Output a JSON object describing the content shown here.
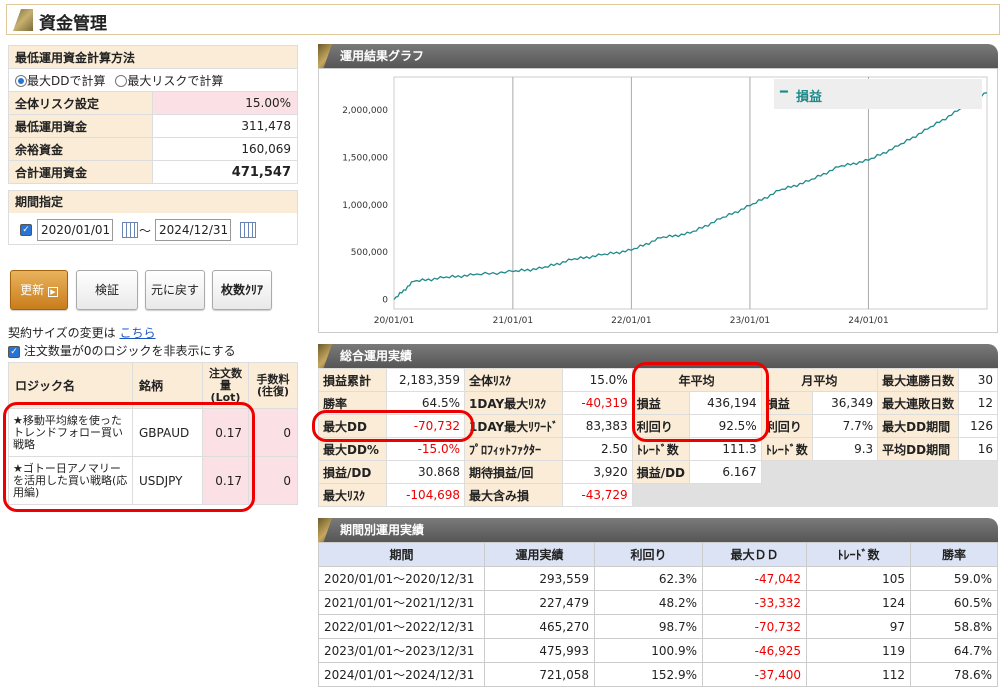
{
  "header": {
    "title": "資金管理"
  },
  "calc": {
    "section_title": "最低運用資金計算方法",
    "radio1": "最大DDで計算",
    "radio2": "最大リスクで計算",
    "rows": [
      {
        "label": "全体リスク設定",
        "value": "15.00%"
      },
      {
        "label": "最低運用資金",
        "value": "311,478"
      },
      {
        "label": "余裕資金",
        "value": "160,069"
      },
      {
        "label": "合計運用資金",
        "value": "471,547"
      }
    ]
  },
  "period": {
    "section_title": "期間指定",
    "from": "2020/01/01",
    "sep": "～",
    "to": "2024/12/31"
  },
  "buttons": {
    "update": "更新",
    "verify": "検証",
    "reset": "元に戻す",
    "clear": "枚数ｸﾘｱ"
  },
  "contract": {
    "text": "契約サイズの変更は",
    "link": "こちら",
    "hide_zero": "注文数量が0のロジックを非表示にする"
  },
  "logic_table": {
    "headers": {
      "name": "ロジック名",
      "symbol": "銘柄",
      "lot": "注文数量(Lot)",
      "fee": "手数料(往復)"
    },
    "rows": [
      {
        "name": "★移動平均線を使ったトレンドフォロー買い戦略",
        "symbol": "GBPAUD",
        "lot": "0.17",
        "fee": "0"
      },
      {
        "name": "★ゴトー日アノマリーを活用した買い戦略(応用編)",
        "symbol": "USDJPY",
        "lot": "0.17",
        "fee": "0"
      }
    ]
  },
  "graph": {
    "section_title": "運用結果グラフ"
  },
  "chart_data": {
    "type": "line",
    "title": "",
    "legend": "損益",
    "legend_position": "top-right",
    "grid": true,
    "x_ticks": [
      "20/01/01",
      "21/01/01",
      "22/01/01",
      "23/01/01",
      "24/01/01"
    ],
    "y_ticks": [
      "0",
      "500,000",
      "1,000,000",
      "1,500,000",
      "2,000,000"
    ],
    "ylim": [
      -100000,
      2350000
    ],
    "series": [
      {
        "name": "損益",
        "color": "#1f8a8a",
        "x": [
          "2020-01-01",
          "2020-03-01",
          "2020-06-01",
          "2020-09-01",
          "2021-01-01",
          "2021-04-01",
          "2021-07-01",
          "2021-10-01",
          "2022-01-01",
          "2022-04-01",
          "2022-07-01",
          "2022-10-01",
          "2023-01-01",
          "2023-04-01",
          "2023-07-01",
          "2023-10-01",
          "2024-01-01",
          "2024-04-01",
          "2024-07-01",
          "2024-10-01",
          "2024-12-31"
        ],
        "values": [
          0,
          190000,
          230000,
          260000,
          295000,
          330000,
          420000,
          470000,
          520000,
          650000,
          700000,
          850000,
          990000,
          1150000,
          1250000,
          1400000,
          1470000,
          1620000,
          1800000,
          1990000,
          2183359
        ]
      }
    ]
  },
  "summary": {
    "section_title": "総合運用実績",
    "col1": [
      {
        "k": "損益累計",
        "v": "2,183,359"
      },
      {
        "k": "勝率",
        "v": "64.5%"
      },
      {
        "k": "最大DD",
        "v": "-70,732",
        "red": true
      },
      {
        "k": "最大DD%",
        "v": "-15.0%",
        "red": true
      },
      {
        "k": "損益/DD",
        "v": "30.868"
      },
      {
        "k": "最大ﾘｽｸ",
        "v": "-104,698",
        "red": true
      }
    ],
    "col2": [
      {
        "k": "全体ﾘｽｸ",
        "v": "15.0%"
      },
      {
        "k": "1DAY最大ﾘｽｸ",
        "v": "-40,319",
        "red": true
      },
      {
        "k": "1DAY最大ﾘﾜｰﾄﾞ",
        "v": "83,383"
      },
      {
        "k": "ﾌﾟﾛﾌｨｯﾄﾌｧｸﾀｰ",
        "v": "2.50"
      },
      {
        "k": "期待損益/回",
        "v": "3,920"
      },
      {
        "k": "最大含み損",
        "v": "-43,729",
        "red": true
      }
    ],
    "yearly": {
      "title": "年平均",
      "rows": [
        {
          "k": "損益",
          "v": "436,194"
        },
        {
          "k": "利回り",
          "v": "92.5%"
        },
        {
          "k": "ﾄﾚｰﾄﾞ数",
          "v": "111.3"
        },
        {
          "k": "損益/DD",
          "v": "6.167"
        }
      ]
    },
    "monthly": {
      "title": "月平均",
      "rows": [
        {
          "k": "損益",
          "v": "36,349"
        },
        {
          "k": "利回り",
          "v": "7.7%"
        },
        {
          "k": "ﾄﾚｰﾄﾞ数",
          "v": "9.3"
        }
      ]
    },
    "col5": [
      {
        "k": "最大連勝日数",
        "v": "30"
      },
      {
        "k": "最大連敗日数",
        "v": "12"
      },
      {
        "k": "最大DD期間",
        "v": "126"
      },
      {
        "k": "平均DD期間",
        "v": "16"
      }
    ]
  },
  "periods": {
    "section_title": "期間別運用実績",
    "headers": [
      "期間",
      "運用実績",
      "利回り",
      "最大ＤＤ",
      "ﾄﾚｰﾄﾞ数",
      "勝率"
    ],
    "rows": [
      [
        "2020/01/01～2020/12/31",
        "293,559",
        "62.3%",
        "-47,042",
        "105",
        "59.0%"
      ],
      [
        "2021/01/01～2021/12/31",
        "227,479",
        "48.2%",
        "-33,332",
        "124",
        "60.5%"
      ],
      [
        "2022/01/01～2022/12/31",
        "465,270",
        "98.7%",
        "-70,732",
        "97",
        "58.8%"
      ],
      [
        "2023/01/01～2023/12/31",
        "475,993",
        "100.9%",
        "-46,925",
        "119",
        "64.7%"
      ],
      [
        "2024/01/01～2024/12/31",
        "721,058",
        "152.9%",
        "-37,400",
        "112",
        "78.6%"
      ]
    ]
  }
}
